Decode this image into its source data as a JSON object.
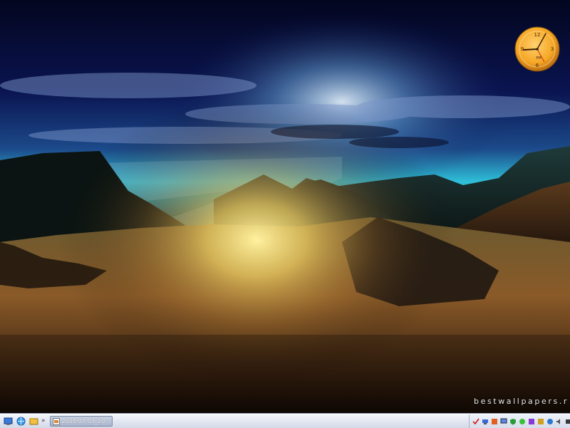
{
  "desktop": {
    "watermark": "bestwallpapers.r",
    "colors": {
      "sky_top": "#05082a",
      "horizon_glow": "#2fc0d8",
      "ground": "#8a5a28",
      "sun_glow": "#f4e070"
    }
  },
  "clock_widget": {
    "meridiem": "PM",
    "numerals": {
      "n12": "12",
      "n3": "3",
      "n6": "6",
      "n9": "9"
    },
    "face_color": "#f5a623"
  },
  "taskbar": {
    "quick_launch": [
      {
        "name": "show-desktop-icon"
      },
      {
        "name": "browser-icon"
      },
      {
        "name": "explorer-icon"
      }
    ],
    "quick_launch_more": "»",
    "window_button_label": "2008-07-03_20...",
    "tray_icons": [
      "red-check-icon",
      "network-icon",
      "speaker-icon",
      "monitor-icon",
      "shield-icon",
      "chat-icon",
      "antivirus-icon",
      "update-icon",
      "globe-icon",
      "volume-icon",
      "power-icon"
    ]
  }
}
